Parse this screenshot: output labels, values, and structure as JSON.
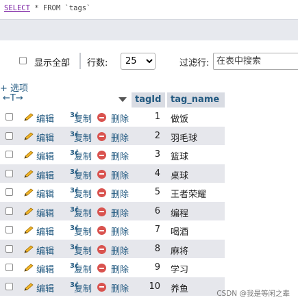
{
  "query": {
    "keyword_select": "SELECT",
    "middle": " * ",
    "keyword_from": "FROM",
    "table": " `tags`"
  },
  "toolbar": {
    "show_all_label": "显示全部",
    "rows_label": "行数:",
    "rows_value": "25",
    "filter_label": "过滤行:",
    "filter_placeholder": "在表中搜索"
  },
  "table": {
    "options_label": "+ 选项",
    "columns": [
      "tagId",
      "tag_name"
    ],
    "action_labels": {
      "edit": "编辑",
      "copy": "复制",
      "delete": "删除"
    },
    "rows": [
      {
        "id": "1",
        "name": "做饭"
      },
      {
        "id": "2",
        "name": "羽毛球"
      },
      {
        "id": "3",
        "name": "篮球"
      },
      {
        "id": "4",
        "name": "桌球"
      },
      {
        "id": "5",
        "name": "王者荣耀"
      },
      {
        "id": "6",
        "name": "编程"
      },
      {
        "id": "7",
        "name": "喝酒"
      },
      {
        "id": "8",
        "name": "麻将"
      },
      {
        "id": "9",
        "name": "学习"
      },
      {
        "id": "10",
        "name": "养鱼"
      }
    ]
  },
  "watermark": "CSDN @我是等闲之辈",
  "colors": {
    "link": "#235a81",
    "header_bg": "#d9dce3",
    "odd_row_bg": "#e6e7ec",
    "delete_icon": "#d9534f"
  }
}
